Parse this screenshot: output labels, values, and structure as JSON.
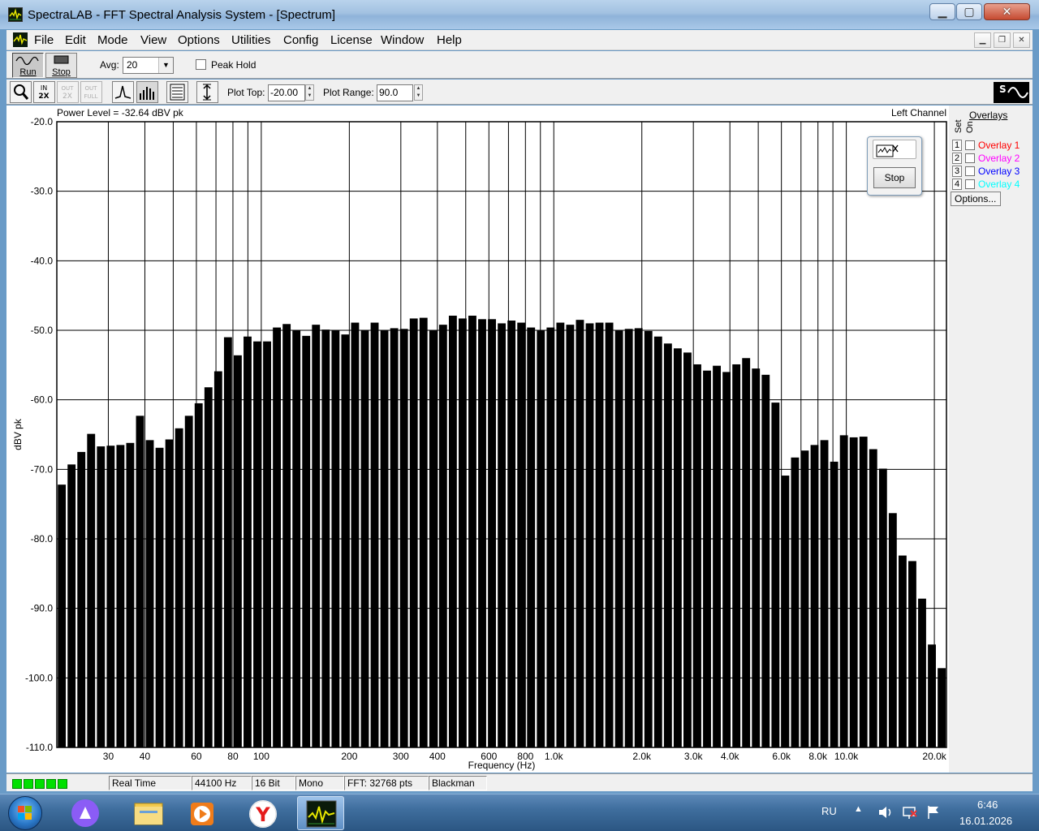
{
  "window": {
    "title": "SpectraLAB - FFT Spectral Analysis System - [Spectrum]"
  },
  "menu": [
    "File",
    "Edit",
    "Mode",
    "View",
    "Options",
    "Utilities",
    "Config",
    "License",
    "Window",
    "Help"
  ],
  "toolbar": {
    "run_label": "Run",
    "stop_label": "Stop",
    "avg_label": "Avg:",
    "avg_value": "20",
    "peak_hold_label": "Peak Hold",
    "plot_top_label": "Plot Top:",
    "plot_top_value": "-20.00",
    "plot_range_label": "Plot Range:",
    "plot_range_value": "90.0",
    "zoom_in_label": "IN 2X",
    "zoom_out_label": "OUT 2X",
    "zoom_full_label": "OUT FULL"
  },
  "plot": {
    "power_level": "Power Level = -32.64 dBV pk",
    "channel": "Left Channel",
    "background": "#ffffff",
    "bar_color": "#000000"
  },
  "overlays": {
    "header": "Overlays",
    "set_label": "Set",
    "on_label": "On",
    "items": [
      {
        "num": "1",
        "name": "Overlay 1",
        "color": "#ff0000"
      },
      {
        "num": "2",
        "name": "Overlay 2",
        "color": "#ff00ff"
      },
      {
        "num": "3",
        "name": "Overlay 3",
        "color": "#0000ff"
      },
      {
        "num": "4",
        "name": "Overlay 4",
        "color": "#00ffff"
      }
    ],
    "options_label": "Options..."
  },
  "float_window": {
    "stop_label": "Stop"
  },
  "status": {
    "mode": "Real Time",
    "rate": "44100 Hz",
    "bits": "16 Bit",
    "channels": "Mono",
    "fft": "FFT: 32768 pts",
    "window": "Blackman"
  },
  "taskbar": {
    "lang": "RU",
    "time": "6:46",
    "date": "16.01.2026"
  },
  "chart_data": {
    "type": "bar",
    "xlabel": "Frequency (Hz)",
    "ylabel": "dBV pk",
    "xscale": "log",
    "xlim": [
      20,
      22000
    ],
    "ylim": [
      -110,
      -20
    ],
    "grid": true,
    "y_ticks": [
      "-20.0",
      "-30.0",
      "-40.0",
      "-50.0",
      "-60.0",
      "-70.0",
      "-80.0",
      "-90.0",
      "-100.0",
      "-110.0"
    ],
    "x_ticks": [
      {
        "value": 30,
        "label": "30"
      },
      {
        "value": 40,
        "label": "40"
      },
      {
        "value": 60,
        "label": "60"
      },
      {
        "value": 80,
        "label": "80"
      },
      {
        "value": 100,
        "label": "100"
      },
      {
        "value": 200,
        "label": "200"
      },
      {
        "value": 300,
        "label": "300"
      },
      {
        "value": 400,
        "label": "400"
      },
      {
        "value": 600,
        "label": "600"
      },
      {
        "value": 800,
        "label": "800"
      },
      {
        "value": 1000,
        "label": "1.0k"
      },
      {
        "value": 2000,
        "label": "2.0k"
      },
      {
        "value": 3000,
        "label": "3.0k"
      },
      {
        "value": 4000,
        "label": "4.0k"
      },
      {
        "value": 6000,
        "label": "6.0k"
      },
      {
        "value": 8000,
        "label": "8.0k"
      },
      {
        "value": 10000,
        "label": "10.0k"
      },
      {
        "value": 20000,
        "label": "20.0k"
      }
    ],
    "x_gridlines": [
      30,
      40,
      50,
      60,
      70,
      80,
      90,
      100,
      200,
      300,
      400,
      500,
      600,
      700,
      800,
      900,
      1000,
      2000,
      3000,
      4000,
      5000,
      6000,
      7000,
      8000,
      9000,
      10000,
      20000
    ],
    "values": [
      -72.2,
      -69.3,
      -67.5,
      -64.9,
      -66.7,
      -66.6,
      -66.5,
      -66.2,
      -62.3,
      -65.8,
      -66.9,
      -65.7,
      -64.1,
      -62.3,
      -60.5,
      -58.2,
      -55.9,
      -51.0,
      -53.6,
      -50.9,
      -51.6,
      -51.6,
      -49.6,
      -49.1,
      -50.0,
      -50.8,
      -49.2,
      -49.9,
      -50.0,
      -50.6,
      -48.9,
      -50.0,
      -48.9,
      -50.0,
      -49.7,
      -49.8,
      -48.3,
      -48.2,
      -50.0,
      -49.2,
      -47.9,
      -48.3,
      -47.9,
      -48.4,
      -48.4,
      -49.0,
      -48.6,
      -48.9,
      -49.6,
      -50.0,
      -49.6,
      -48.9,
      -49.2,
      -48.5,
      -49.0,
      -48.9,
      -48.9,
      -50.0,
      -49.8,
      -49.7,
      -50.1,
      -50.9,
      -51.9,
      -52.6,
      -53.2,
      -54.9,
      -55.8,
      -55.1,
      -56.0,
      -54.9,
      -54.0,
      -55.5,
      -56.4,
      -60.4,
      -70.9,
      -68.3,
      -67.3,
      -66.5,
      -65.8,
      -68.9,
      -65.1,
      -65.4,
      -65.3,
      -67.1,
      -69.9,
      -76.3,
      -82.4,
      -83.2,
      -88.6,
      -95.2,
      -98.6
    ]
  }
}
